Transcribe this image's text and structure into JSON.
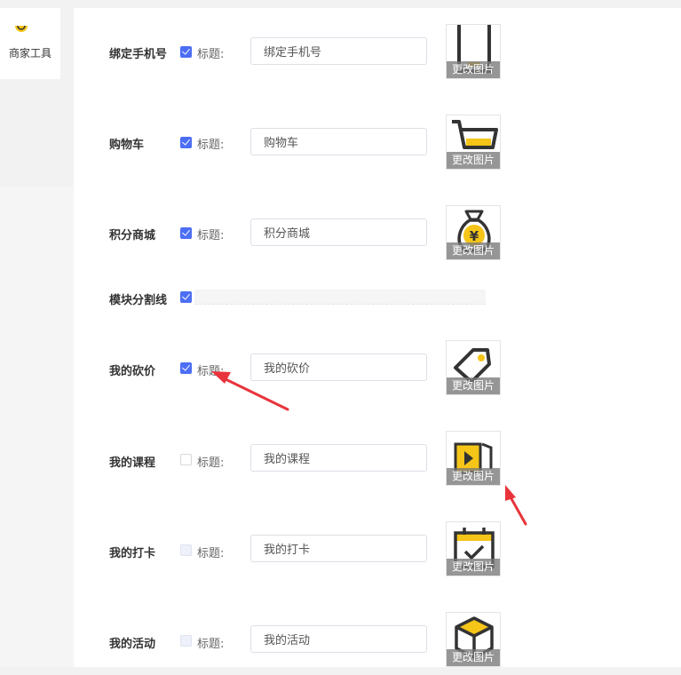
{
  "sidebar": {
    "merchant_tools_label": "商家工具"
  },
  "form": {
    "title_label": "标题:",
    "change_image_label": "更改图片",
    "rows": [
      {
        "label": "绑定手机号",
        "checked": true,
        "title_value": "绑定手机号",
        "icon": "phone-icon"
      },
      {
        "label": "购物车",
        "checked": true,
        "title_value": "购物车",
        "icon": "shopping-cart-icon"
      },
      {
        "label": "积分商城",
        "checked": true,
        "title_value": "积分商城",
        "icon": "money-bag-icon"
      },
      {
        "label": "我的砍价",
        "checked": true,
        "title_value": "我的砍价",
        "icon": "price-tag-icon"
      },
      {
        "label": "我的课程",
        "checked": false,
        "title_value": "我的课程",
        "icon": "video-course-icon"
      },
      {
        "label": "我的打卡",
        "checked": false,
        "title_value": "我的打卡",
        "icon": "calendar-check-icon"
      },
      {
        "label": "我的活动",
        "checked": false,
        "title_value": "我的活动",
        "icon": "box-icon"
      }
    ],
    "divider_row": {
      "label": "模块分割线",
      "checked": true
    }
  },
  "colors": {
    "accent": "#4c6ef5",
    "icon_yellow": "#f5c518",
    "icon_dark": "#333333",
    "annotation_arrow": "#e8343b"
  }
}
